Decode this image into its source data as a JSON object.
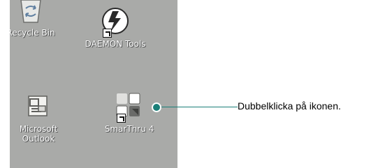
{
  "desktop": {
    "icons": [
      {
        "label": "Recycle Bin",
        "icon": "recycle-bin-icon"
      },
      {
        "label": "DAEMON Tools",
        "icon": "daemon-tools-icon"
      },
      {
        "label": "Microsoft\nOutlook",
        "icon": "outlook-icon"
      },
      {
        "label": "SmarThru 4",
        "icon": "smarthru-icon"
      }
    ]
  },
  "callout": {
    "text": "Dubbelklicka på ikonen."
  },
  "colors": {
    "desktop": "#a9aaa8",
    "callout": "#1a7f78"
  }
}
